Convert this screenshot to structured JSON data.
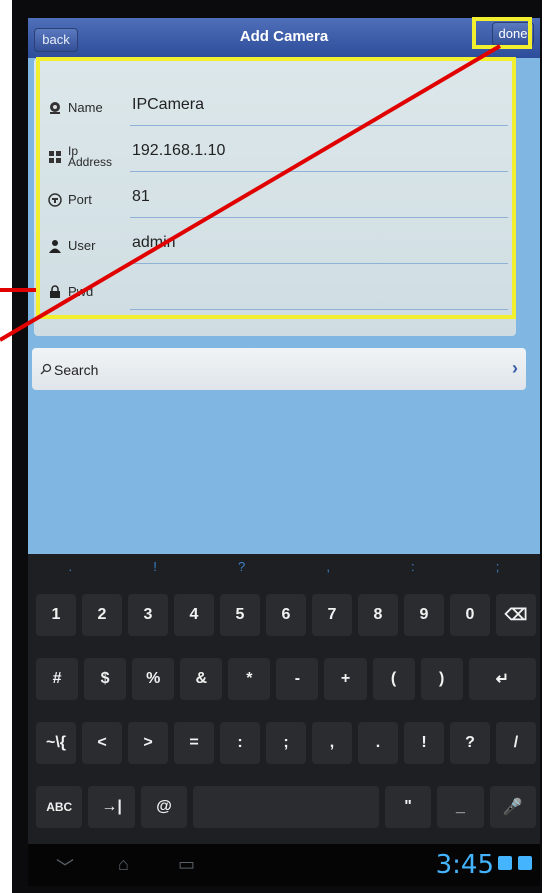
{
  "navbar": {
    "back_label": "back",
    "title": "Add Camera",
    "done_label": "done"
  },
  "form": {
    "rows": [
      {
        "label": "Name",
        "value": "IPCamera",
        "icon": "camera-icon"
      },
      {
        "label": "Ip Address",
        "value": "192.168.1.10",
        "icon": "network-icon"
      },
      {
        "label": "Port",
        "value": "81",
        "icon": "port-icon"
      },
      {
        "label": "User",
        "value": "admin",
        "icon": "user-icon"
      },
      {
        "label": "Pwd",
        "value": "",
        "icon": "lock-icon"
      }
    ]
  },
  "search": {
    "label": "Search",
    "icon": "search-icon"
  },
  "keyboard": {
    "hints": [
      ".",
      "!",
      "?",
      ",",
      ":",
      ";"
    ],
    "row1": [
      "1",
      "2",
      "3",
      "4",
      "5",
      "6",
      "7",
      "8",
      "9",
      "0",
      "⌫"
    ],
    "row2": [
      "#",
      "$",
      "%",
      "&",
      "*",
      "-",
      "+",
      "(",
      ")",
      "↵"
    ],
    "row3": [
      "~\\{",
      "<",
      ">",
      "=",
      ":",
      ";",
      ",",
      ".",
      "!",
      "?",
      "/"
    ],
    "row4_left": [
      "ABC",
      "→|",
      "@"
    ],
    "row4_right": [
      "\"",
      "_",
      "🎤"
    ]
  },
  "status": {
    "time": "3:45"
  },
  "colors": {
    "annotation_yellow": "#f2ef2e",
    "annotation_red": "#e10000",
    "nav_blue": "#2d4c99",
    "screen_blue": "#7fb6e2"
  }
}
